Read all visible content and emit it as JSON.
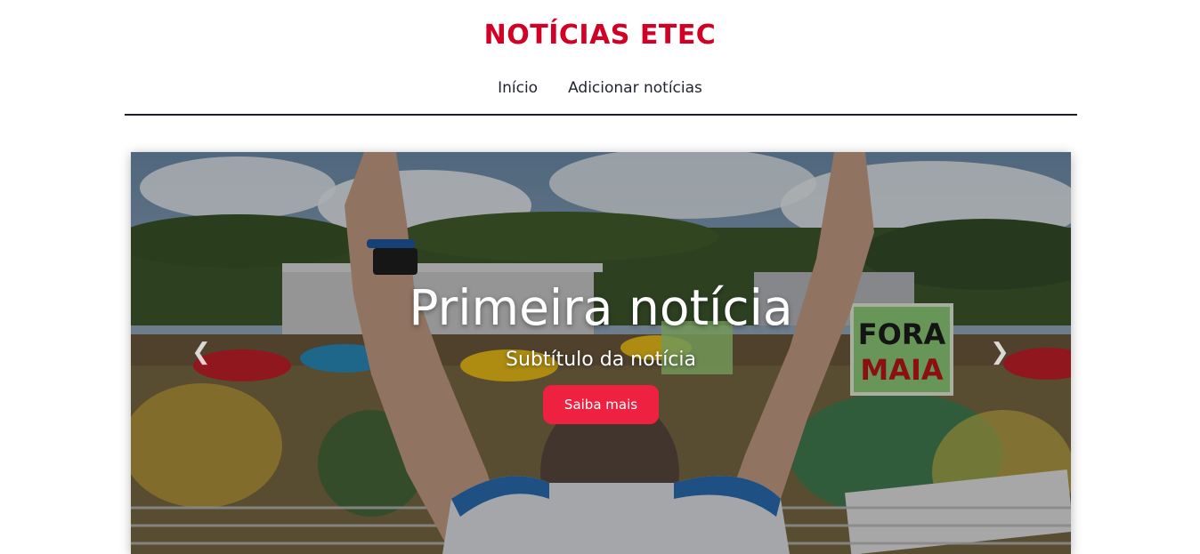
{
  "header": {
    "brand": "NOTÍCIAS ETEC",
    "nav": [
      {
        "label": "Início"
      },
      {
        "label": "Adicionar notícias"
      }
    ]
  },
  "carousel": {
    "slide": {
      "title": "Primeira notícia",
      "subtitle": "Subtítulo da notícia",
      "button_label": "Saiba mais",
      "sign_text_line1": "FORA",
      "sign_text_line2": "MAIA"
    },
    "prev_icon": "chevron-left-icon",
    "next_icon": "chevron-right-icon"
  },
  "colors": {
    "brand": "#d10024",
    "button": "#ee2140",
    "nav_text": "#1f2430"
  }
}
